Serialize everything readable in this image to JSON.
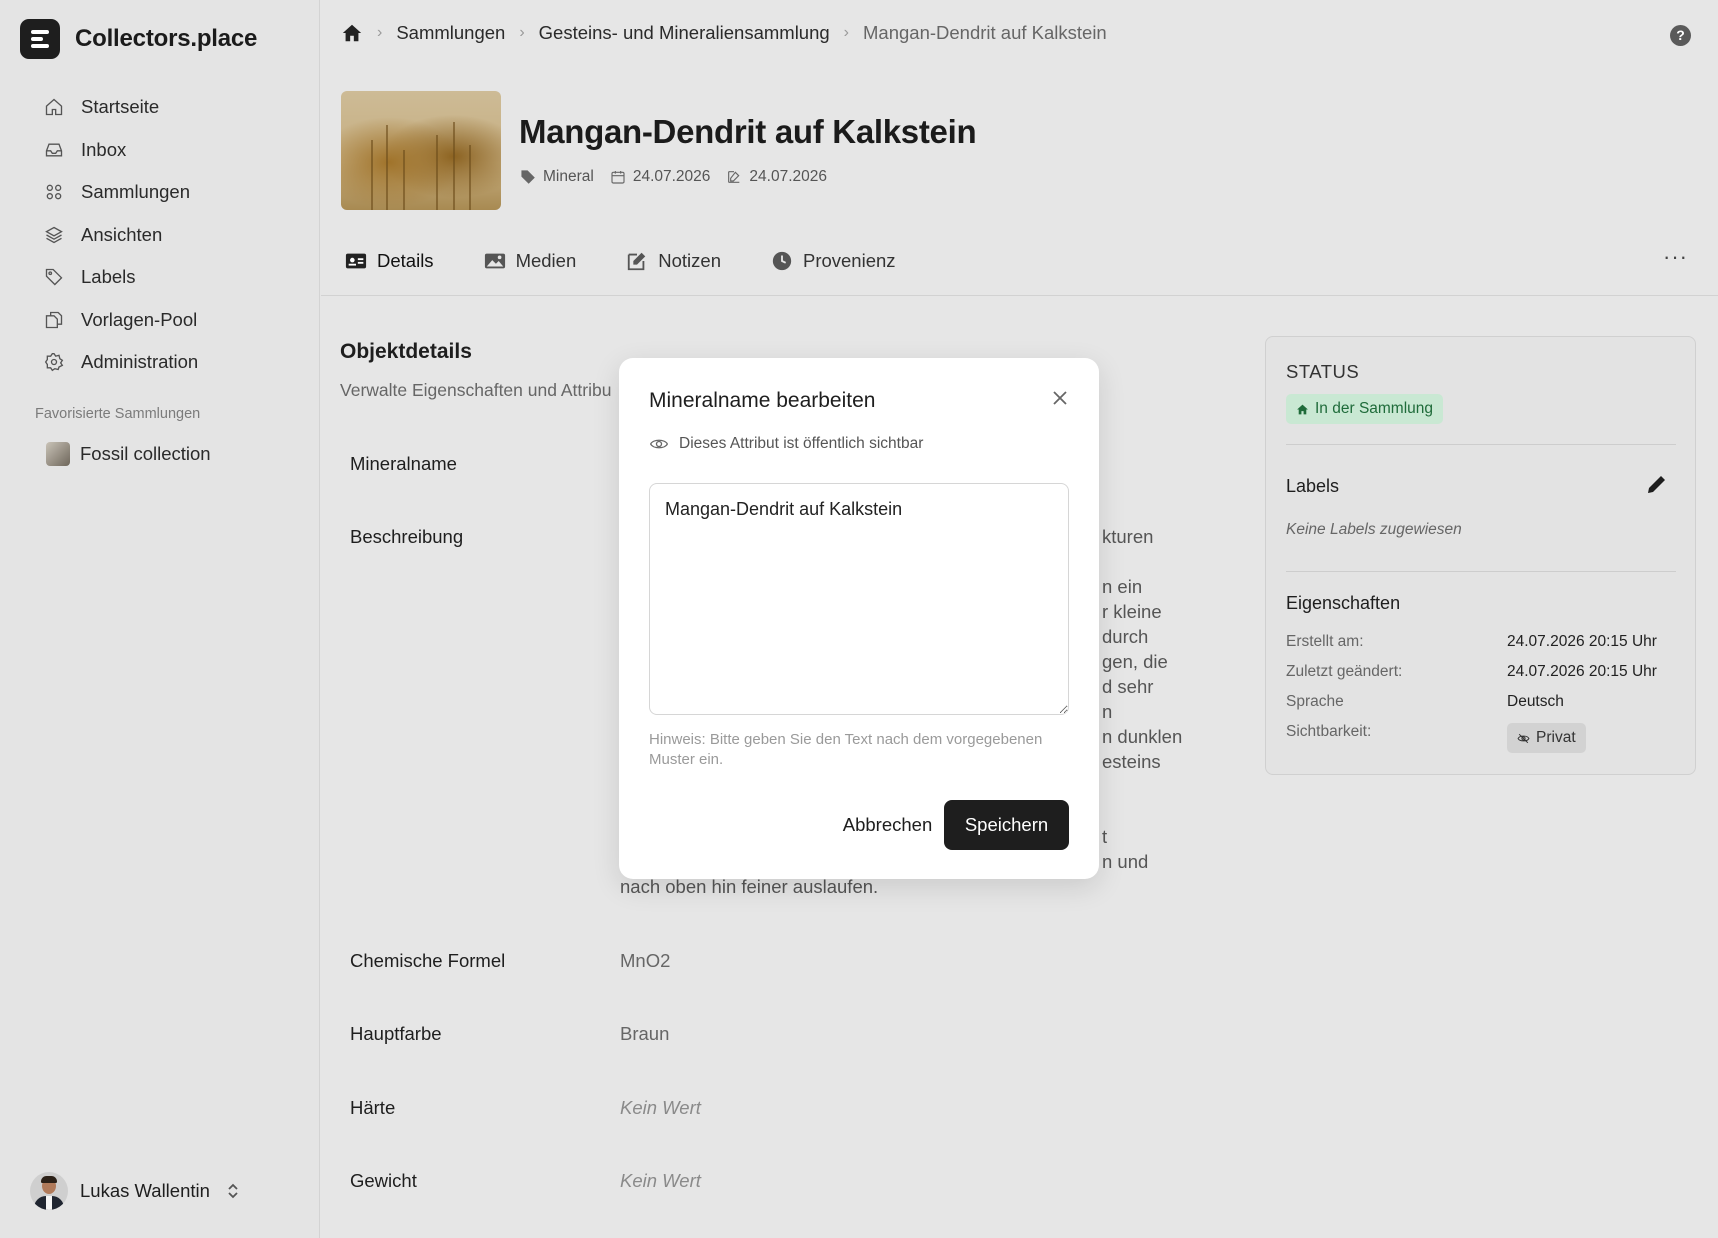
{
  "app": {
    "name": "Collectors.place"
  },
  "sidebar": {
    "items": [
      {
        "label": "Startseite",
        "icon": "home-icon"
      },
      {
        "label": "Inbox",
        "icon": "inbox-icon"
      },
      {
        "label": "Sammlungen",
        "icon": "grid-icon"
      },
      {
        "label": "Ansichten",
        "icon": "layers-icon"
      },
      {
        "label": "Labels",
        "icon": "tag-icon"
      },
      {
        "label": "Vorlagen-Pool",
        "icon": "copy-icon"
      },
      {
        "label": "Administration",
        "icon": "gear-icon"
      }
    ],
    "favorites_title": "Favorisierte Sammlungen",
    "favorites": [
      {
        "label": "Fossil collection"
      }
    ],
    "user": {
      "name": "Lukas Wallentin"
    }
  },
  "breadcrumb": {
    "items": [
      "Sammlungen",
      "Gesteins- und Mineraliensammlung"
    ],
    "current": "Mangan-Dendrit auf Kalkstein"
  },
  "object": {
    "title": "Mangan-Dendrit auf Kalkstein",
    "type": "Mineral",
    "created": "24.07.2026",
    "modified": "24.07.2026"
  },
  "tabs": [
    {
      "label": "Details",
      "active": true
    },
    {
      "label": "Medien"
    },
    {
      "label": "Notizen"
    },
    {
      "label": "Provenienz"
    }
  ],
  "details": {
    "title": "Objektdetails",
    "subtitle": "Verwalte Eigenschaften und Attribu",
    "rows": {
      "mineralname": {
        "label": "Mineralname"
      },
      "beschreibung": {
        "label": "Beschreibung"
      },
      "formel": {
        "label": "Chemische Formel",
        "value": "MnO2"
      },
      "farbe": {
        "label": "Hauptfarbe",
        "value": "Braun"
      },
      "haerte": {
        "label": "Härte",
        "value": "Kein Wert"
      },
      "gewicht": {
        "label": "Gewicht",
        "value": "Kein Wert"
      }
    },
    "desc_fragments": [
      "kturen",
      "n ein",
      "r kleine",
      "durch",
      "gen, die",
      "d sehr",
      "n",
      "n dunklen",
      "esteins",
      "t",
      "n und",
      "nach oben hin feiner auslaufen."
    ]
  },
  "status_panel": {
    "title": "STATUS",
    "status": "In der Sammlung",
    "labels_title": "Labels",
    "labels_empty": "Keine Labels zugewiesen",
    "props_title": "Eigenschaften",
    "props": [
      {
        "key": "Erstellt am:",
        "value": "24.07.2026 20:15 Uhr"
      },
      {
        "key": "Zuletzt geändert:",
        "value": "24.07.2026 20:15 Uhr"
      },
      {
        "key": "Sprache",
        "value": "Deutsch"
      },
      {
        "key": "Sichtbarkeit:",
        "value": "Privat"
      }
    ]
  },
  "modal": {
    "title": "Mineralname bearbeiten",
    "visibility": "Dieses Attribut ist öffentlich sichtbar",
    "value": "Mangan-Dendrit auf Kalkstein",
    "hint": "Hinweis: Bitte geben Sie den Text nach dem vorgegebenen Muster ein.",
    "cancel": "Abbrechen",
    "save": "Speichern"
  },
  "colors": {
    "accent": "#1e1e1e",
    "status_bg": "#c9e8d3",
    "status_fg": "#1f6b3a"
  }
}
